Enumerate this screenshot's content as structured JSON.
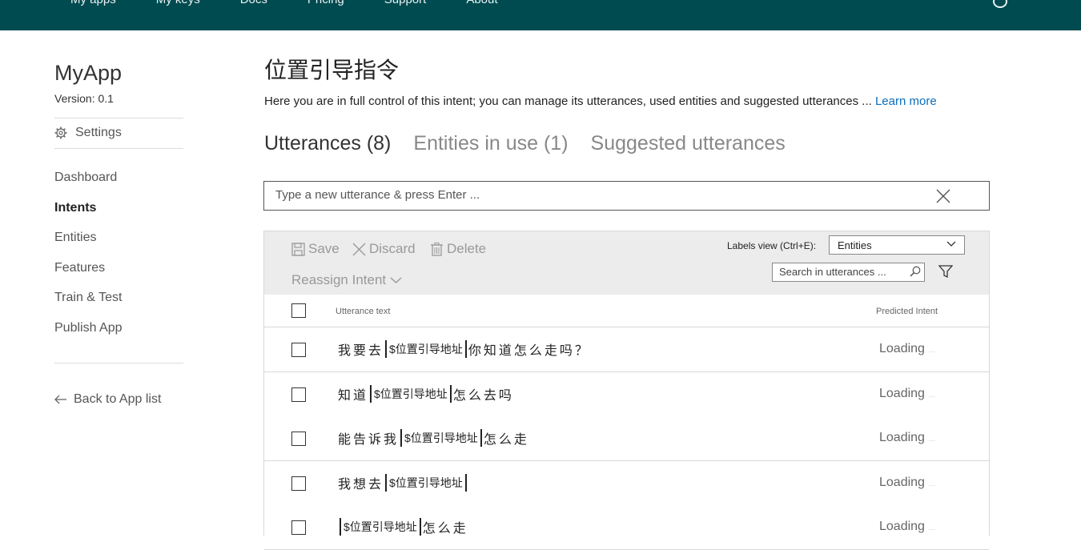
{
  "topnav": [
    "My apps",
    "My keys",
    "Docs",
    "Pricing",
    "Support",
    "About"
  ],
  "sidebar": {
    "app_name": "MyApp",
    "version": "Version:  0.1",
    "settings_label": "Settings",
    "items": [
      {
        "label": "Dashboard",
        "active": false
      },
      {
        "label": "Intents",
        "active": true
      },
      {
        "label": "Entities",
        "active": false
      },
      {
        "label": "Features",
        "active": false
      },
      {
        "label": "Train & Test",
        "active": false
      },
      {
        "label": "Publish App",
        "active": false
      }
    ],
    "back_label": "Back to App list"
  },
  "main": {
    "title": "位置引导指令",
    "description": "Here you are in full control of this intent; you can manage its utterances, used entities and suggested utterances ... ",
    "learn_more": "Learn more",
    "tabs": [
      {
        "label": "Utterances (8)",
        "active": true
      },
      {
        "label": "Entities in use (1)",
        "active": false
      },
      {
        "label": "Suggested utterances",
        "active": false
      }
    ],
    "utterance_placeholder": "Type a new utterance & press Enter ..."
  },
  "toolbar": {
    "save_label": "Save",
    "discard_label": "Discard",
    "delete_label": "Delete",
    "reassign_label": "Reassign Intent",
    "labels_view_label": "Labels view (Ctrl+E):",
    "labels_view_value": "Entities",
    "search_placeholder": "Search in utterances ..."
  },
  "table": {
    "col_text": "Utterance text",
    "col_intent": "Predicted Intent",
    "rows": [
      {
        "before": "我要去",
        "entity": "$位置引导地址",
        "after": "你知道怎么走吗？",
        "intent": "Loading"
      },
      {
        "before": "知道",
        "entity": "$位置引导地址",
        "after": "怎么去吗",
        "intent": "Loading"
      },
      {
        "before": "能告诉我",
        "entity": "$位置引导地址",
        "after": "怎么走",
        "intent": "Loading"
      },
      {
        "before": "我想去",
        "entity": "$位置引导地址",
        "after": "",
        "intent": "Loading"
      },
      {
        "before": "",
        "entity": "$位置引导地址",
        "after": "怎么走",
        "intent": "Loading"
      }
    ]
  },
  "colors": {
    "topbar": "#004b50",
    "link": "#0a6ebd"
  }
}
